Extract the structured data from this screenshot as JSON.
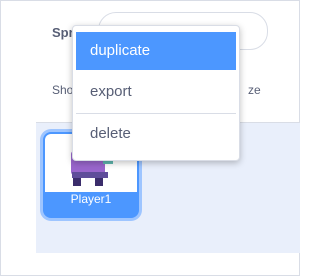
{
  "sprite_info": {
    "sprite_label": "Spr",
    "show_label": "Sho",
    "size_label": "ze"
  },
  "sprite_list": {
    "tiles": [
      {
        "name": "Player1",
        "selected": true
      }
    ]
  },
  "context_menu": {
    "items": [
      {
        "label": "duplicate",
        "highlighted": true
      },
      {
        "label": "export",
        "highlighted": false
      },
      {
        "label": "delete",
        "highlighted": false
      }
    ]
  },
  "colors": {
    "accent": "#4c97ff",
    "tile_glow": "#9ec5ff",
    "pane_background": "#e9effb",
    "text": "#575e75",
    "border": "#d9dde6",
    "costume_purple": "#9966cc",
    "costume_teal": "#5fb8b0"
  }
}
